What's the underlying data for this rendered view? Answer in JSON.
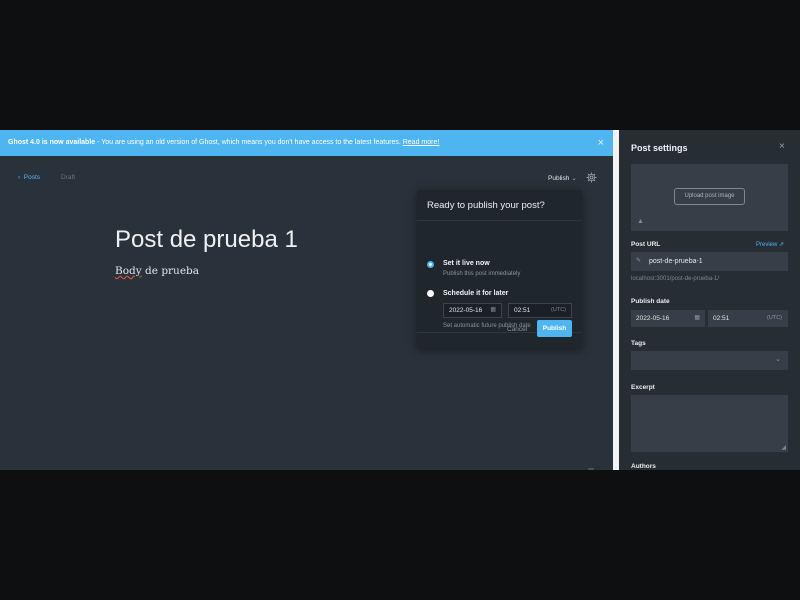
{
  "banner": {
    "title": "Ghost 4.0 is now available",
    "message": " - You are using an old version of Ghost, which means you don't have access to the latest features. ",
    "link": "Read more!",
    "close": "×"
  },
  "toolbar": {
    "back_arrow": "‹",
    "back_label": "Posts",
    "status": "Draft",
    "publish_label": "Publish",
    "publish_chevron": "⌄"
  },
  "post": {
    "title": "Post de prueba 1",
    "body_word1": "Body",
    "body_rest": " de prueba"
  },
  "publish_popup": {
    "heading": "Ready to publish your post?",
    "option_now_label": "Set it live now",
    "option_now_sub": "Publish this post immediately",
    "option_later_label": "Schedule it for later",
    "date": "2022-05-16",
    "time": "02:51",
    "timezone": "(UTC)",
    "calendar_glyph": "▦",
    "later_sub": "Set automatic future publish date",
    "cancel": "Cancel",
    "publish": "Publish",
    "selected_option": "now"
  },
  "settings": {
    "title": "Post settings",
    "close": "×",
    "upload_image": "Upload post image",
    "image_icon_glyph": "▲",
    "post_url_label": "Post URL",
    "preview_link": "Preview ⇗",
    "pen_glyph": "✎",
    "slug": "post-de-prueba-1",
    "url_hint": "localhost:3001/post-de-prueba-1/",
    "publish_date_label": "Publish date",
    "date": "2022-05-16",
    "time": "02:51",
    "timezone": "(UTC)",
    "calendar_glyph": "▦",
    "tags_label": "Tags",
    "tags_chevron": "⌄",
    "excerpt_label": "Excerpt",
    "resize_glyph": "◢",
    "authors_label": "Authors"
  },
  "colors": {
    "accent": "#4fb5f0",
    "editor_bg": "#29323a",
    "panel_bg": "#262d33"
  },
  "icons": {
    "gear": "gear-icon",
    "close": "close-icon",
    "calendar": "calendar-icon",
    "pencil": "pencil-icon",
    "image": "image-icon",
    "chevron": "chevron-down-icon"
  }
}
